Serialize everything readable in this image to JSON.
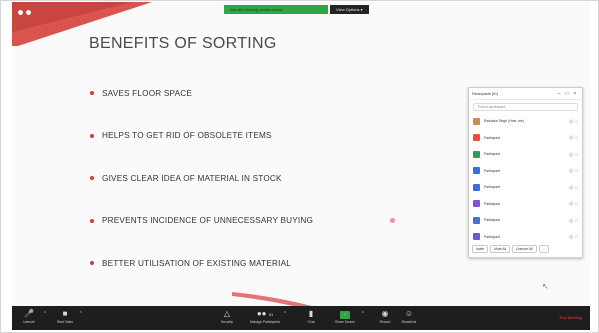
{
  "share_banner": {
    "status": "You are viewing screen share",
    "view_options": "View Options ▾"
  },
  "slide": {
    "title": "BENEFITS OF SORTING",
    "bullets": [
      "SAVES FLOOR SPACE",
      "HELPS TO GET RID OF OBSOLETE ITEMS",
      "GIVES CLEAR IDEA OF MATERIAL IN STOCK",
      "PREVENTS INCIDENCE OF UNNECESSARY BUYING",
      "BETTER UTILISATION OF EXISTING MATERIAL"
    ]
  },
  "participants": {
    "title": "Participants (51)",
    "search_placeholder": "Find a participant",
    "rows": [
      {
        "name": "Ravindra Singh (Host, me)",
        "color": "#c98a4a"
      },
      {
        "name": "Participant",
        "color": "#e0543a"
      },
      {
        "name": "Participant",
        "color": "#2f9e56"
      },
      {
        "name": "Participant",
        "color": "#3a6fd8"
      },
      {
        "name": "Participant",
        "color": "#3a6fd8"
      },
      {
        "name": "Participant",
        "color": "#7f55d6"
      },
      {
        "name": "Participant",
        "color": "#4b6ed6"
      },
      {
        "name": "Participant",
        "color": "#6a5ad6"
      }
    ],
    "footer": {
      "invite": "Invite",
      "mute_all": "Mute All",
      "unmute_all": "Unmute All",
      "more": "..."
    }
  },
  "toolbar": {
    "unmute": "Unmute",
    "start_video": "Start Video",
    "security": "Security",
    "manage_participants": "Manage Participants",
    "participant_count": "51",
    "chat": "Chat",
    "share_screen": "Share Screen",
    "record": "Record",
    "reactions": "Reactions",
    "end_meeting": "End Meeting"
  }
}
